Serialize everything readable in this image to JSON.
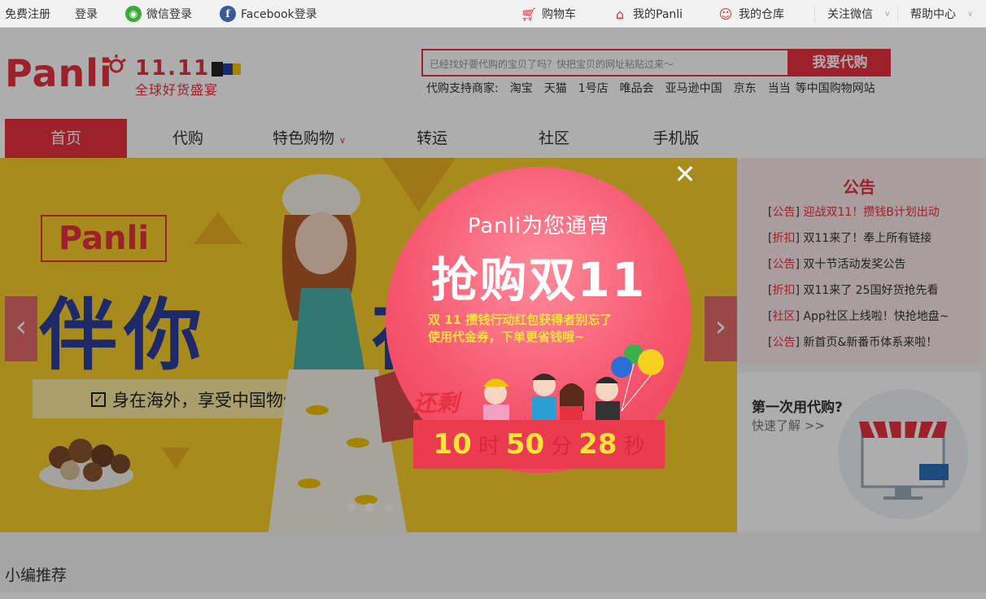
{
  "topbar": {
    "register": "免费注册",
    "login": "登录",
    "wechat_login": "微信登录",
    "facebook_login": "Facebook登录",
    "cart": "购物车",
    "my_panli": "我的Panli",
    "warehouse": "我的仓库",
    "follow_wechat": "关注微信",
    "help": "帮助中心"
  },
  "header": {
    "logo": "Panli",
    "event_number": "11.11",
    "event_subtitle": "全球好货盛宴",
    "search_placeholder": "已经找好要代购的宝贝了吗？快把宝贝的网址粘贴过来～",
    "search_button": "我要代购",
    "merchants_label": "代购支持商家:",
    "merchants": [
      "淘宝",
      "天猫",
      "1号店",
      "唯品会",
      "亚马逊中国",
      "京东",
      "当当",
      "等中国购物网站"
    ]
  },
  "nav": [
    "首页",
    "代购",
    "特色购物",
    "转运",
    "社区",
    "手机版"
  ],
  "banner": {
    "brand": "Panli",
    "headline": "伴你",
    "slogan1": "身在海外，享受中国物价！",
    "slogan2": "思念"
  },
  "notice": {
    "title": "公告",
    "items": [
      {
        "tag": "公告",
        "text": "迎战双11！攒钱B计划出动"
      },
      {
        "tag": "折扣",
        "text": "双11来了！奉上所有链接"
      },
      {
        "tag": "公告",
        "text": "双十节活动发奖公告"
      },
      {
        "tag": "折扣",
        "text": "双11来了 25国好货抢先看"
      },
      {
        "tag": "社区",
        "text": "App社区上线啦！快抢地盘~"
      },
      {
        "tag": "公告",
        "text": "新首页&新番币体系来啦！"
      }
    ]
  },
  "first_time": {
    "title": "第一次用代购?",
    "link": "快速了解 >>"
  },
  "section": {
    "title": "小编推荐"
  },
  "popup": {
    "greeting": "Panli为您通宵",
    "title": "抢购双11",
    "desc_line1": "双 11 攒钱行动红包获得者别忘了",
    "desc_line2": "使用代金券，下单更省钱哦~",
    "countdown_label": "还剩",
    "hours": "10",
    "hours_unit": "时",
    "minutes": "50",
    "minutes_unit": "分",
    "seconds": "28",
    "seconds_unit": "秒"
  }
}
